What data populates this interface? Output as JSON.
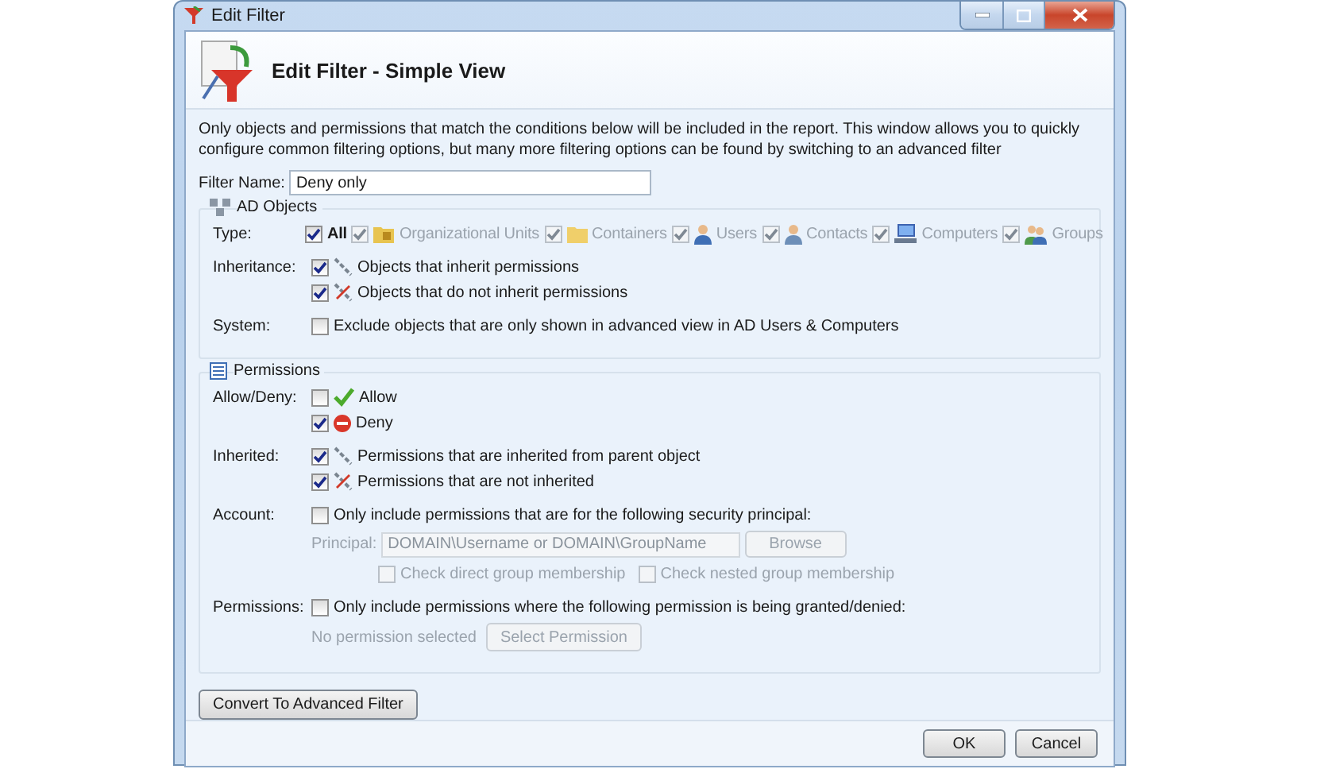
{
  "window": {
    "title": "Edit Filter"
  },
  "header": {
    "title": "Edit Filter - Simple View"
  },
  "description": "Only objects and permissions that match the conditions below will be included in the report. This window allows you to quickly configure common filtering options, but many more filtering options can be found by switching to an advanced filter",
  "filter_name": {
    "label": "Filter Name:",
    "value": "Deny only"
  },
  "ad_objects": {
    "title": "AD Objects",
    "rows": [
      {
        "label": "Type:",
        "kind": "inline",
        "options": [
          {
            "label": "All",
            "checked": true,
            "disabled": false,
            "kind": "plain"
          },
          {
            "label": "Organizational Units",
            "checked": true,
            "disabled": true,
            "kind": "ou"
          },
          {
            "label": "Containers",
            "checked": true,
            "disabled": true,
            "kind": "container"
          },
          {
            "label": "Users",
            "checked": true,
            "disabled": true,
            "kind": "user"
          },
          {
            "label": "Contacts",
            "checked": true,
            "disabled": true,
            "kind": "contact"
          },
          {
            "label": "Computers",
            "checked": true,
            "disabled": true,
            "kind": "computer"
          },
          {
            "label": "Groups",
            "checked": true,
            "disabled": true,
            "kind": "group"
          }
        ]
      },
      {
        "label": "Inheritance:",
        "kind": "stacked",
        "options": [
          {
            "label": "Objects that inherit permissions",
            "checked": true,
            "disabled": false,
            "kind": "inherit"
          },
          {
            "label": "Objects that do not inherit permissions",
            "checked": true,
            "disabled": false,
            "kind": "noinherit"
          }
        ]
      },
      {
        "label": "System:",
        "kind": "stacked",
        "options": [
          {
            "label": "Exclude objects that are only shown in advanced view in AD Users & Computers",
            "checked": false,
            "disabled": false,
            "kind": "plain"
          }
        ]
      }
    ]
  },
  "permissions": {
    "title": "Permissions",
    "rows": [
      {
        "label": "Allow/Deny:",
        "kind": "stacked",
        "options": [
          {
            "label": "Allow",
            "checked": false,
            "disabled": false,
            "kind": "allow"
          },
          {
            "label": "Deny",
            "checked": true,
            "disabled": false,
            "kind": "deny"
          }
        ]
      },
      {
        "label": "Inherited:",
        "kind": "stacked",
        "options": [
          {
            "label": "Permissions that are inherited from parent object",
            "checked": true,
            "disabled": false,
            "kind": "inherit"
          },
          {
            "label": "Permissions that are not inherited",
            "checked": true,
            "disabled": false,
            "kind": "noinherit"
          }
        ]
      },
      {
        "label": "Account:",
        "kind": "stacked",
        "options": [
          {
            "label": "Only include permissions that are for the following security principal:",
            "checked": false,
            "disabled": false,
            "kind": "plain"
          }
        ],
        "principal": {
          "label": "Principal:",
          "placeholder": "DOMAIN\\Username or DOMAIN\\GroupName",
          "button": "Browse",
          "disabled": true,
          "checks": [
            {
              "label": "Check direct group membership",
              "checked": false,
              "disabled": true
            },
            {
              "label": "Check nested group membership",
              "checked": false,
              "disabled": true
            }
          ]
        }
      },
      {
        "label": "Permissions:",
        "kind": "stacked",
        "options": [
          {
            "label": "Only include permissions where the following permission is being granted/denied:",
            "checked": false,
            "disabled": false,
            "kind": "plain"
          }
        ],
        "permission": {
          "text": "No permission selected",
          "button": "Select Permission",
          "disabled": true
        }
      }
    ]
  },
  "convert_button": "Convert To Advanced Filter",
  "buttons": [
    "OK",
    "Cancel"
  ]
}
